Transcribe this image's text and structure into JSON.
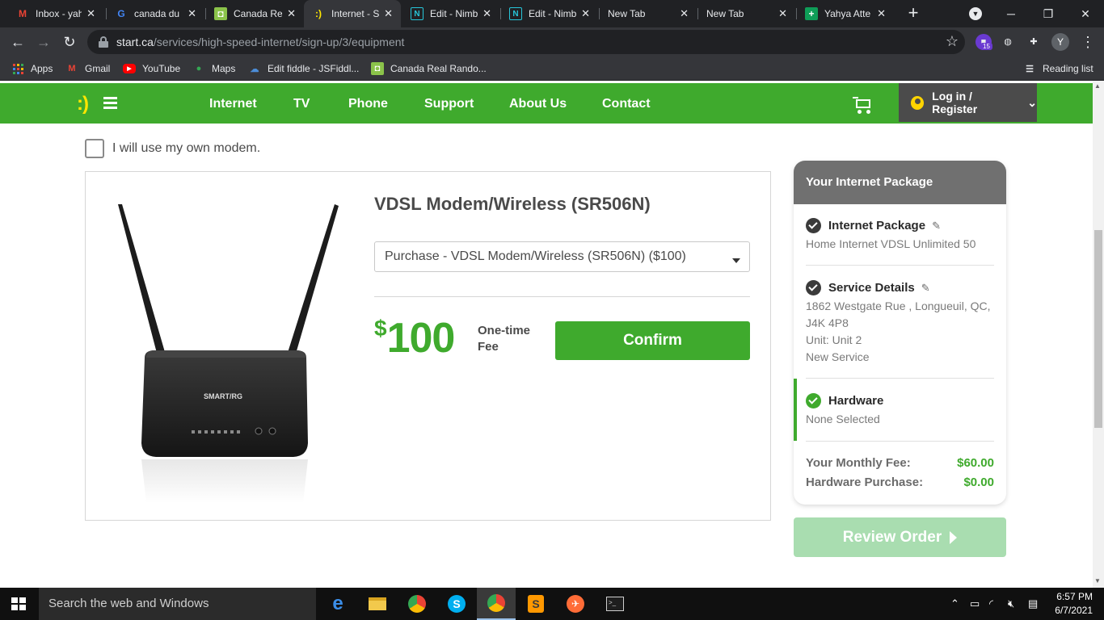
{
  "tabs": [
    {
      "title": "Inbox - yah",
      "favicon": "M",
      "favicon_color": "#ea4335"
    },
    {
      "title": "canada du",
      "favicon": "G",
      "favicon_color": "#4285f4"
    },
    {
      "title": "Canada Re",
      "favicon": "◘",
      "favicon_color": "#8bc34a"
    },
    {
      "title": "Internet - S",
      "favicon": ":)",
      "favicon_color": "#ffe600"
    },
    {
      "title": "Edit - Nimb",
      "favicon": "N",
      "favicon_color": "#27c5d8"
    },
    {
      "title": "Edit - Nimb",
      "favicon": "N",
      "favicon_color": "#27c5d8"
    },
    {
      "title": "New Tab",
      "favicon": "",
      "favicon_color": "#e8eaed"
    },
    {
      "title": "New Tab",
      "favicon": "",
      "favicon_color": "#e8eaed"
    },
    {
      "title": "Yahya Atte",
      "favicon": "+",
      "favicon_color": "#0f9d58"
    }
  ],
  "address": {
    "host": "start.ca",
    "path": "/services/high-speed-internet/sign-up/3/equipment"
  },
  "extensions": {
    "badge": "15",
    "profile_initial": "Y"
  },
  "bookmarks": {
    "apps": "Apps",
    "items": [
      {
        "label": "Gmail"
      },
      {
        "label": "YouTube"
      },
      {
        "label": "Maps"
      },
      {
        "label": "Edit fiddle - JSFiddl..."
      },
      {
        "label": "Canada Real Rando..."
      }
    ],
    "reading_list": "Reading list"
  },
  "site": {
    "logo": ":)",
    "nav": [
      "Internet",
      "TV",
      "Phone",
      "Support",
      "About Us",
      "Contact"
    ],
    "login": "Log in / Register",
    "brand_color": "#3faa2d"
  },
  "equipment": {
    "own_modem_label": "I will use my own modem.",
    "product_title": "VDSL Modem/Wireless (SR506N)",
    "selected_option": "Purchase - VDSL Modem/Wireless (SR506N) ($100)",
    "price_currency": "$",
    "price_amount": "100",
    "fee_line1": "One-time",
    "fee_line2": "Fee",
    "confirm_label": "Confirm",
    "router_brand": "SMART/RG"
  },
  "package": {
    "heading": "Your Internet Package",
    "internet": {
      "title": "Internet Package",
      "line": "Home Internet VDSL Unlimited 50"
    },
    "service": {
      "title": "Service Details",
      "lines": [
        "1862 Westgate Rue , Longueuil, QC,",
        "J4K 4P8",
        "Unit: Unit 2",
        "New Service"
      ]
    },
    "hardware": {
      "title": "Hardware",
      "line": "None Selected"
    },
    "monthly_label": "Your Monthly Fee:",
    "monthly_value": "$60.00",
    "hardware_label": "Hardware Purchase:",
    "hardware_value": "$0.00",
    "review_label": "Review Order"
  },
  "taskbar": {
    "search_placeholder": "Search the web and Windows",
    "time": "6:57 PM",
    "date": "6/7/2021"
  }
}
